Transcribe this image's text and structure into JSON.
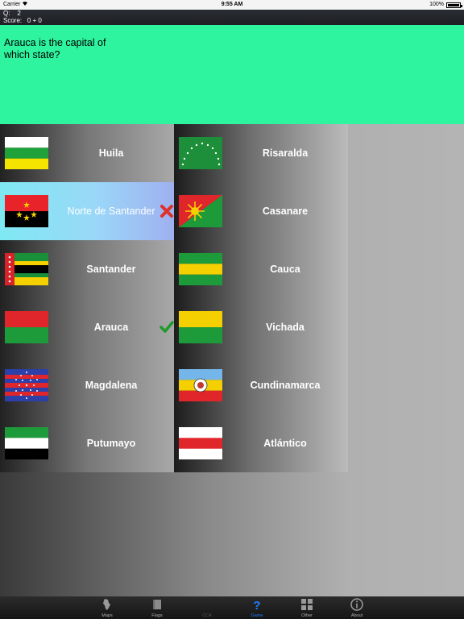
{
  "status_bar": {
    "carrier": "Carrier",
    "time": "9:55 AM",
    "battery": "100%"
  },
  "score_bar": {
    "question_label": "Q:",
    "question_number": "2",
    "score_label": "Score:",
    "score_value": "0 + 0"
  },
  "question": {
    "text": "Arauca is the capital of which state?"
  },
  "options_left": [
    {
      "label": "Huila"
    },
    {
      "label": "Norte de Santander",
      "state": "selected-wrong"
    },
    {
      "label": "Santander"
    },
    {
      "label": "Arauca",
      "state": "correct"
    },
    {
      "label": "Magdalena"
    },
    {
      "label": "Putumayo"
    }
  ],
  "options_right": [
    {
      "label": "Risaralda"
    },
    {
      "label": "Casanare"
    },
    {
      "label": "Cauca"
    },
    {
      "label": "Vichada"
    },
    {
      "label": "Cundinamarca"
    },
    {
      "label": "Atlántico"
    }
  ],
  "tab_bar": {
    "tabs": [
      {
        "label": "Maps",
        "icon": "map-icon"
      },
      {
        "label": "Flags",
        "icon": "flag-icon"
      },
      {
        "label": "CCA",
        "icon": "none",
        "state": "disabled"
      },
      {
        "label": "Game",
        "icon": "question-icon",
        "state": "active"
      },
      {
        "label": "Other",
        "icon": "grid-icon"
      },
      {
        "label": "About",
        "icon": "info-icon"
      }
    ]
  },
  "colors": {
    "question_bg": "#2ef39f",
    "selected_row": "#8fdaf6",
    "active_tab": "#1e7cff",
    "wrong_mark": "#e0302a",
    "correct_mark": "#1d9a2a"
  }
}
